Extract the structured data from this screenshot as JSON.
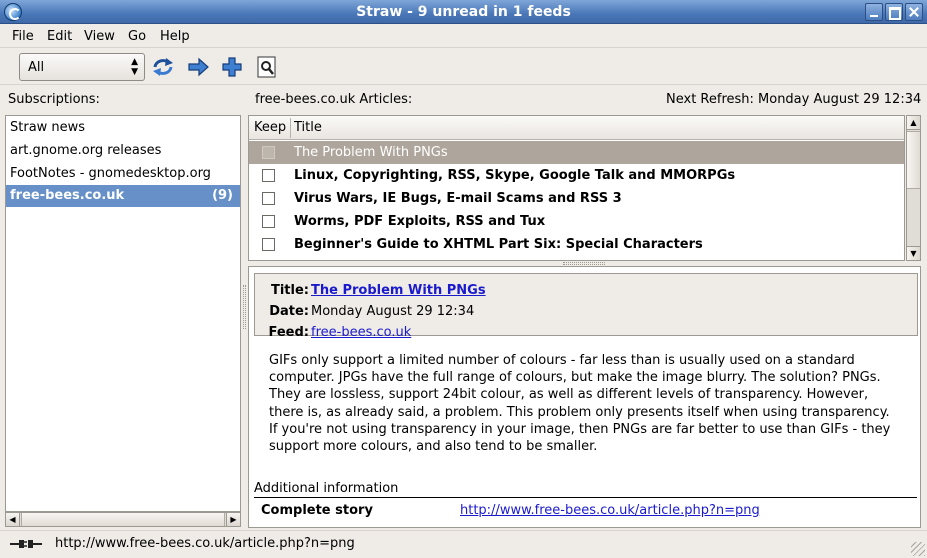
{
  "window": {
    "title": "Straw - 9 unread in 1 feeds"
  },
  "menu": {
    "file": "File",
    "edit": "Edit",
    "view": "View",
    "go": "Go",
    "help": "Help"
  },
  "toolbar": {
    "filter_value": "All",
    "icons": [
      "refresh-icon",
      "next-arrow-icon",
      "add-icon",
      "find-icon"
    ]
  },
  "labels": {
    "subscriptions": "Subscriptions:",
    "articles_prefix": "free-bees.co.uk ",
    "articles_word": "Articles:",
    "next_refresh": "Next Refresh: Monday August 29 12:34"
  },
  "subscriptions": [
    {
      "name": "Straw news",
      "count": ""
    },
    {
      "name": "art.gnome.org releases",
      "count": ""
    },
    {
      "name": "FootNotes - gnomedesktop.org",
      "count": ""
    },
    {
      "name": "free-bees.co.uk",
      "count": "(9)"
    }
  ],
  "article_columns": {
    "keep": "Keep",
    "title": "Title"
  },
  "articles": [
    {
      "title": "The Problem With PNGs",
      "keep": false
    },
    {
      "title": "Linux, Copyrighting, RSS, Skype, Google Talk and MMORPGs",
      "keep": false
    },
    {
      "title": "Virus Wars, IE Bugs, E-mail Scams and RSS 3",
      "keep": false
    },
    {
      "title": "Worms, PDF Exploits, RSS and Tux",
      "keep": false
    },
    {
      "title": "Beginner's Guide to XHTML Part Six: Special Characters",
      "keep": false
    }
  ],
  "article_detail": {
    "title_label": "Title:",
    "title": "The Problem With PNGs",
    "date_label": "Date:",
    "date": "Monday August 29 12:34",
    "feed_label": "Feed:",
    "feed": "free-bees.co.uk",
    "body": "GIFs only support a limited number of colours - far less than is usually used on a standard computer. JPGs have the full range of colours, but make the image blurry. The solution? PNGs. They are lossless, support 24bit colour, as well as different levels of transparency. However, there is, as already said, a problem. This problem only presents itself when using transparency. If you're not using transparency in your image, then PNGs are far better to use than GIFs - they support more colours, and also tend to be smaller.",
    "additional_info": "Additional information",
    "complete_story_label": "Complete story",
    "complete_story_url": "http://www.free-bees.co.uk/article.php?n=png"
  },
  "status": {
    "text": "http://www.free-bees.co.uk/article.php?n=png"
  },
  "colors": {
    "title_bar": "#4a77b8",
    "selection": "#6790c8",
    "selected_article": "#aea69c",
    "link": "#1a1acc"
  }
}
